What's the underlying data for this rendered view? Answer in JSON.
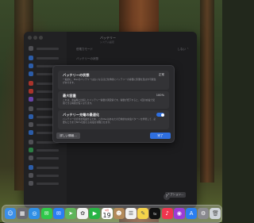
{
  "settings_window": {
    "title": "バッテリー",
    "subtitle": "システム設定",
    "rows": [
      {
        "label": "低電力モード",
        "value": "しない ⌃"
      },
      {
        "label": "バッテリーの状態",
        "value": ""
      }
    ],
    "background_button": "オプション…"
  },
  "sheet": {
    "capacity": {
      "heading": "バッテリーの状態",
      "value": "正常",
      "description": "一般的に、Macのバッテリーは古くなるほど化学的にバッテリーの容量に影響を及ぼす可能性があります。"
    },
    "max_capacity": {
      "heading": "最大容量",
      "value": "100%",
      "description": "これは、新品時と比較したバッテリー容量の測定値です。容量が低下すると、1回の充電で使用できる時間が短くなります。"
    },
    "optimized": {
      "heading": "バッテリー充電の最適化",
      "enabled": true,
      "description": "バッテリーの劣化を軽減するため、このMacはあなたの日常的な充電パターンを学習して、必要なときまで80%を超える充電を待機させます。"
    },
    "learn_more_label": "詳しい情報…",
    "done_label": "完了"
  },
  "help_label": "?",
  "dock": {
    "calendar_month": "9月",
    "calendar_day": "19",
    "tv_label": "tv",
    "items": [
      {
        "name": "finder-icon",
        "color": "#3b8fe8",
        "glyph": "☺"
      },
      {
        "name": "launchpad-icon",
        "color": "#6a6a72",
        "glyph": "▦"
      },
      {
        "name": "safari-icon",
        "color": "#2f8fe6",
        "glyph": "◎"
      },
      {
        "name": "messages-icon",
        "color": "#2fc84a",
        "glyph": "✉"
      },
      {
        "name": "mail-icon",
        "color": "#2a7ef0",
        "glyph": "✉"
      },
      {
        "name": "maps-icon",
        "color": "#5fb55a",
        "glyph": "➤"
      },
      {
        "name": "photos-icon",
        "color": "#f2f2f2",
        "glyph": "✿"
      },
      {
        "name": "facetime-icon",
        "color": "#28b445",
        "glyph": "▶"
      },
      {
        "name": "calendar-icon",
        "color": "#ffffff",
        "glyph": ""
      },
      {
        "name": "contacts-icon",
        "color": "#b38a5a",
        "glyph": "☻"
      },
      {
        "name": "reminders-icon",
        "color": "#f2f2f2",
        "glyph": "☰"
      },
      {
        "name": "notes-icon",
        "color": "#f5d34a",
        "glyph": "✎"
      },
      {
        "name": "tv-icon",
        "color": "#111111",
        "glyph": ""
      },
      {
        "name": "music-icon",
        "color": "#f0364e",
        "glyph": "♪"
      },
      {
        "name": "podcasts-icon",
        "color": "#9b3cd6",
        "glyph": "◉"
      },
      {
        "name": "appstore-icon",
        "color": "#2a7ef0",
        "glyph": "A"
      },
      {
        "name": "settings-icon",
        "color": "#8a8a90",
        "glyph": "⚙"
      },
      {
        "name": "trash-icon",
        "color": "#cfd4da",
        "glyph": "🗑"
      }
    ]
  }
}
